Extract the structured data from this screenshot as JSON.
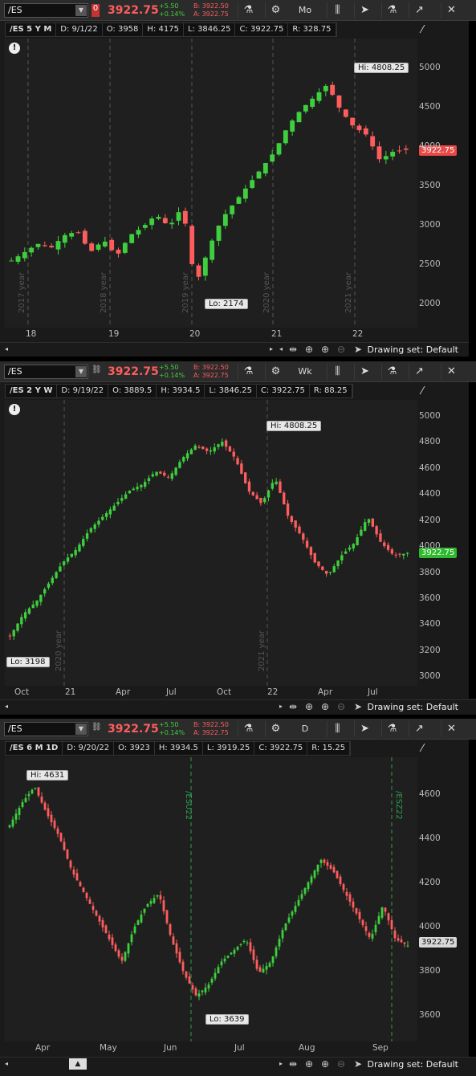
{
  "colors": {
    "up": "#3ecf3e",
    "down": "#ff5d5d",
    "bg": "#1f1f1f",
    "last_red": "#e84a4a",
    "last_green": "#2fb92f"
  },
  "panels": [
    {
      "symbol": "/ES",
      "link": "0",
      "price": "3922.75",
      "change": "+5.50",
      "change_pct": "+0.14%",
      "bid": "B: 3922.50",
      "ask": "A: 3922.75",
      "aggregation": "Mo",
      "ohlc": {
        "desc": "/ES 5 Y M",
        "date": "D: 9/1/22",
        "open": "O: 3958",
        "high": "H: 4175",
        "low": "L: 3846.25",
        "close": "C: 3922.75",
        "range": "R: 328.75"
      },
      "yticks": [
        "5000",
        "4500",
        "4000",
        "3500",
        "3000",
        "2500",
        "2000"
      ],
      "xticks": [
        "18",
        "19",
        "20",
        "21",
        "22"
      ],
      "hi_label": "Hi: 4808.25",
      "lo_label": "Lo: 2174",
      "last_tag": "3922.75",
      "year_labels": [
        "2017 year",
        "2018 year",
        "2019 year",
        "2020 year",
        "2021 year"
      ],
      "drawing_set": "Drawing set: Default"
    },
    {
      "symbol": "/ES",
      "link": "",
      "price": "3922.75",
      "change": "+5.50",
      "change_pct": "+0.14%",
      "bid": "B: 3922.50",
      "ask": "A: 3922.75",
      "aggregation": "Wk",
      "ohlc": {
        "desc": "/ES 2 Y W",
        "date": "D: 9/19/22",
        "open": "O: 3889.5",
        "high": "H: 3934.5",
        "low": "L: 3846.25",
        "close": "C: 3922.75",
        "range": "R: 88.25"
      },
      "yticks": [
        "5000",
        "4800",
        "4600",
        "4400",
        "4200",
        "4000",
        "3800",
        "3600",
        "3400",
        "3200",
        "3000"
      ],
      "xticks": [
        "Oct",
        "21",
        "Apr",
        "Jul",
        "Oct",
        "22",
        "Apr",
        "Jul"
      ],
      "hi_label": "Hi: 4808.25",
      "lo_label": "Lo: 3198",
      "last_tag": "3922.75",
      "year_labels": [
        "2020 year",
        "2021 year"
      ],
      "drawing_set": "Drawing set: Default"
    },
    {
      "symbol": "/ES",
      "link": "",
      "price": "3922.75",
      "change": "+5.50",
      "change_pct": "+0.14%",
      "bid": "B: 3922.50",
      "ask": "A: 3922.75",
      "aggregation": "D",
      "ohlc": {
        "desc": "/ES 6 M 1D",
        "date": "D: 9/20/22",
        "open": "O: 3923",
        "high": "H: 3934.5",
        "low": "L: 3919.25",
        "close": "C: 3922.75",
        "range": "R: 15.25"
      },
      "yticks": [
        "4600",
        "4400",
        "4200",
        "4000",
        "3800",
        "3600"
      ],
      "xticks": [
        "Apr",
        "May",
        "Jun",
        "Jul",
        "Aug",
        "Sep"
      ],
      "hi_label": "Hi: 4631",
      "lo_label": "Lo: 3639",
      "last_tag": "3922.75",
      "contract_labels": [
        "/ESU22",
        "/ESZ22"
      ],
      "drawing_set": "Drawing set: Default"
    }
  ]
}
